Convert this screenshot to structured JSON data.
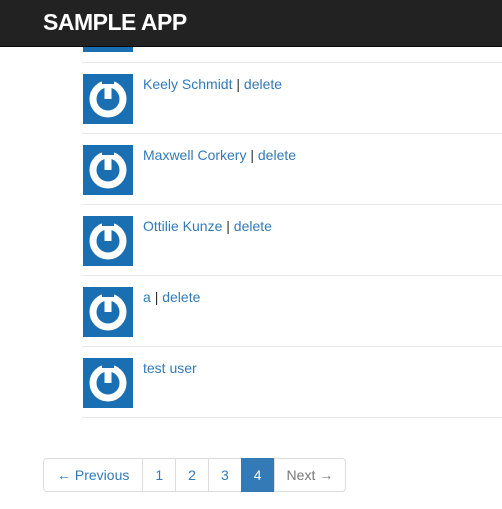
{
  "app": {
    "brand": "SAMPLE APP"
  },
  "users": [
    {
      "name": "Keely Schmidt",
      "separator": "|",
      "delete_label": "delete"
    },
    {
      "name": "Maxwell Corkery",
      "separator": "|",
      "delete_label": "delete"
    },
    {
      "name": "Ottilie Kunze",
      "separator": "|",
      "delete_label": "delete"
    },
    {
      "name": "a",
      "separator": "|",
      "delete_label": "delete"
    },
    {
      "name": "test user"
    }
  ],
  "pagination": {
    "previous_label": "← Previous",
    "pages": [
      "1",
      "2",
      "3",
      "4"
    ],
    "active_page": "4",
    "next_label": "Next →"
  },
  "colors": {
    "link": "#337ab7",
    "navbar": "#222222",
    "avatar": "#1a6fb3"
  }
}
